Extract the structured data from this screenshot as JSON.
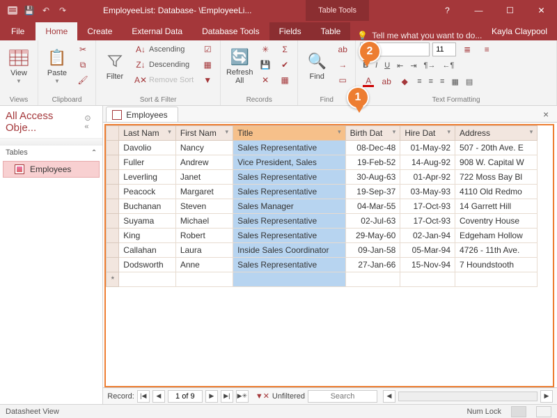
{
  "titlebar": {
    "title": "EmployeeList: Database- \\EmployeeLi...",
    "context_tab": "Table Tools"
  },
  "user": "Kayla Claypool",
  "tell_me": "Tell me what you want to do...",
  "ribbon_tabs": {
    "file": "File",
    "home": "Home",
    "create": "Create",
    "external": "External Data",
    "dbtools": "Database Tools",
    "fields": "Fields",
    "table": "Table"
  },
  "groups": {
    "views": {
      "label": "Views",
      "view": "View"
    },
    "clipboard": {
      "label": "Clipboard",
      "paste": "Paste"
    },
    "sort": {
      "label": "Sort & Filter",
      "filter": "Filter",
      "asc": "Ascending",
      "desc": "Descending",
      "remove": "Remove Sort"
    },
    "records": {
      "label": "Records",
      "refresh": "Refresh\nAll"
    },
    "find": {
      "label": "Find",
      "find": "Find"
    },
    "textfmt": {
      "label": "Text Formatting",
      "font_size": "11"
    }
  },
  "nav": {
    "header": "All Access Obje...",
    "group": "Tables",
    "item": "Employees"
  },
  "tab": {
    "name": "Employees"
  },
  "columns": [
    "Last Nam",
    "First Nam",
    "Title",
    "Birth Dat",
    "Hire Dat",
    "Address"
  ],
  "rows": [
    {
      "last": "Davolio",
      "first": "Nancy",
      "title": "Sales Representative",
      "birth": "08-Dec-48",
      "hire": "01-May-92",
      "addr": "507 - 20th Ave. E"
    },
    {
      "last": "Fuller",
      "first": "Andrew",
      "title": "Vice President, Sales",
      "birth": "19-Feb-52",
      "hire": "14-Aug-92",
      "addr": "908 W. Capital W"
    },
    {
      "last": "Leverling",
      "first": "Janet",
      "title": "Sales Representative",
      "birth": "30-Aug-63",
      "hire": "01-Apr-92",
      "addr": "722 Moss Bay Bl"
    },
    {
      "last": "Peacock",
      "first": "Margaret",
      "title": "Sales Representative",
      "birth": "19-Sep-37",
      "hire": "03-May-93",
      "addr": "4110 Old Redmo"
    },
    {
      "last": "Buchanan",
      "first": "Steven",
      "title": "Sales Manager",
      "birth": "04-Mar-55",
      "hire": "17-Oct-93",
      "addr": "14 Garrett Hill"
    },
    {
      "last": "Suyama",
      "first": "Michael",
      "title": "Sales Representative",
      "birth": "02-Jul-63",
      "hire": "17-Oct-93",
      "addr": "Coventry House"
    },
    {
      "last": "King",
      "first": "Robert",
      "title": "Sales Representative",
      "birth": "29-May-60",
      "hire": "02-Jan-94",
      "addr": "Edgeham Hollow"
    },
    {
      "last": "Callahan",
      "first": "Laura",
      "title": "Inside Sales Coordinator",
      "birth": "09-Jan-58",
      "hire": "05-Mar-94",
      "addr": "4726 - 11th Ave."
    },
    {
      "last": "Dodsworth",
      "first": "Anne",
      "title": "Sales Representative",
      "birth": "27-Jan-66",
      "hire": "15-Nov-94",
      "addr": "7 Houndstooth"
    }
  ],
  "recnav": {
    "label": "Record:",
    "pos": "1 of 9",
    "filter": "Unfiltered",
    "search": "Search"
  },
  "status": {
    "left": "Datasheet View",
    "numlock": "Num Lock"
  },
  "callouts": {
    "c1": "1",
    "c2": "2"
  }
}
